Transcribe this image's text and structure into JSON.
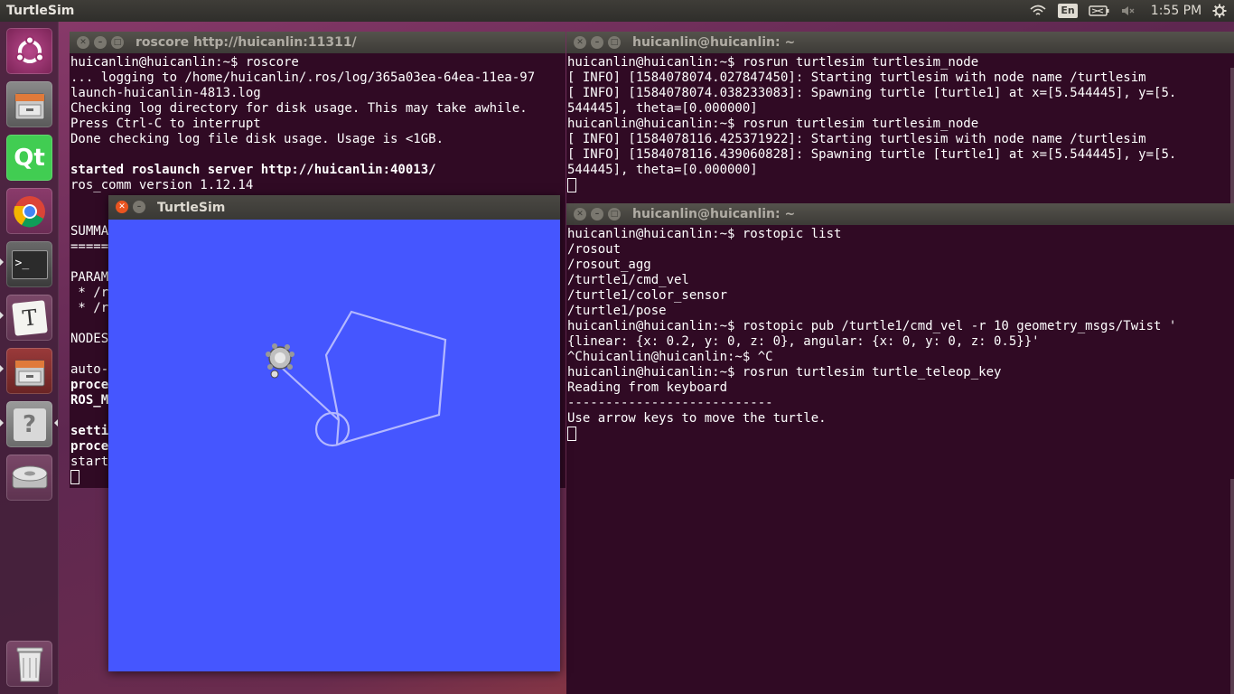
{
  "topbar": {
    "app_name": "TurtleSim",
    "keyboard": "En",
    "time": "1:55 PM"
  },
  "launcher": {
    "items": [
      {
        "name": "ubuntu-dash-icon"
      },
      {
        "name": "files-icon"
      },
      {
        "name": "qt-creator-icon",
        "label": "Qt"
      },
      {
        "name": "chrome-icon"
      },
      {
        "name": "terminal-icon",
        "label": ">_"
      },
      {
        "name": "text-editor-icon",
        "label": "T"
      },
      {
        "name": "files-icon-2"
      },
      {
        "name": "help-icon",
        "label": "?"
      },
      {
        "name": "disk-icon"
      },
      {
        "name": "trash-icon"
      }
    ]
  },
  "roscore": {
    "title": "roscore http://huicanlin:11311/",
    "lines": [
      "huicanlin@huicanlin:~$ roscore",
      "... logging to /home/huicanlin/.ros/log/365a03ea-64ea-11ea-97",
      "launch-huicanlin-4813.log",
      "Checking log directory for disk usage. This may take awhile.",
      "Press Ctrl-C to interrupt",
      "Done checking log file disk usage. Usage is <1GB.",
      "",
      "started roslaunch server http://huicanlin:40013/",
      "ros_comm version 1.12.14",
      "",
      "",
      "SUMMA",
      "=====",
      "",
      "PARAM",
      " * /r",
      " * /r",
      "",
      "NODES",
      "",
      "auto-",
      "proce",
      "ROS_M",
      "",
      "setti",
      "proce",
      "start"
    ],
    "bold_lines": [
      7,
      21,
      22,
      24,
      25
    ]
  },
  "term_top": {
    "title": "huicanlin@huicanlin: ~",
    "lines": [
      "huicanlin@huicanlin:~$ rosrun turtlesim turtlesim_node",
      "[ INFO] [1584078074.027847450]: Starting turtlesim with node name /turtlesim",
      "[ INFO] [1584078074.038233083]: Spawning turtle [turtle1] at x=[5.544445], y=[5.",
      "544445], theta=[0.000000]",
      "huicanlin@huicanlin:~$ rosrun turtlesim turtlesim_node",
      "[ INFO] [1584078116.425371922]: Starting turtlesim with node name /turtlesim",
      "[ INFO] [1584078116.439060828]: Spawning turtle [turtle1] at x=[5.544445], y=[5.",
      "544445], theta=[0.000000]"
    ]
  },
  "term_bottom": {
    "title": "huicanlin@huicanlin: ~",
    "lines": [
      "huicanlin@huicanlin:~$ rostopic list",
      "/rosout",
      "/rosout_agg",
      "/turtle1/cmd_vel",
      "/turtle1/color_sensor",
      "/turtle1/pose",
      "huicanlin@huicanlin:~$ rostopic pub /turtle1/cmd_vel -r 10 geometry_msgs/Twist '",
      "{linear: {x: 0.2, y: 0, z: 0}, angular: {x: 0, y: 0, z: 0.5}}'",
      "^Chuicanlin@huicanlin:~$ ^C",
      "huicanlin@huicanlin:~$ rosrun turtlesim turtle_teleop_key",
      "Reading from keyboard",
      "---------------------------",
      "Use arrow keys to move the turtle."
    ]
  },
  "turtlesim": {
    "title": "TurtleSim",
    "background": "#4556ff",
    "pen_color": "#b3b8ff"
  }
}
